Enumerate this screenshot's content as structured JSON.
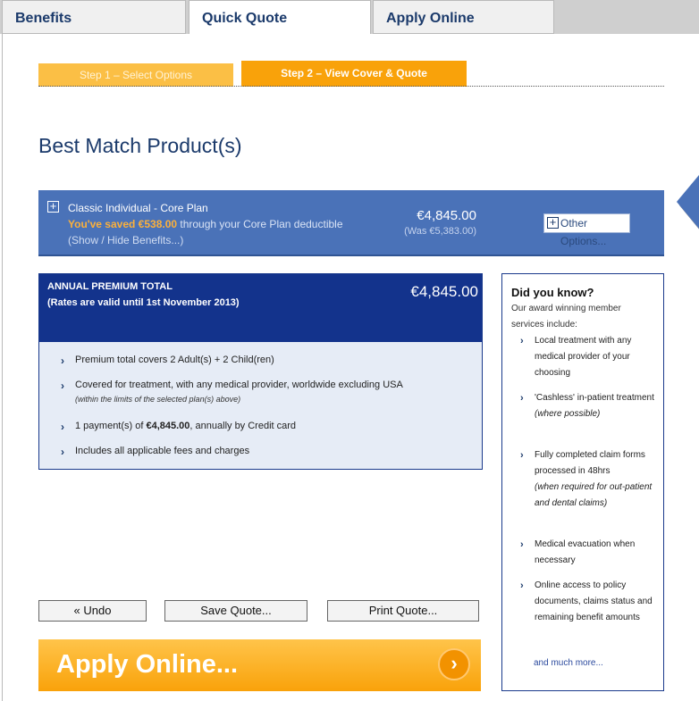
{
  "tabs": [
    {
      "label": "Benefits"
    },
    {
      "label": "Quick Quote"
    },
    {
      "label": "Apply Online"
    }
  ],
  "steps": [
    {
      "label": "Step 1 – Select Options"
    },
    {
      "label": "Step 2 – View Cover & Quote"
    }
  ],
  "page_title": "Best Match Product(s)",
  "plan": {
    "name": "Classic Individual - Core Plan",
    "saved_highlight": "You've saved €538.00",
    "saved_rest": " through your Core Plan deductible",
    "toggle": "(Show / Hide Benefits...)",
    "price": "€4,845.00",
    "was_price": "(Was €5,383.00)",
    "other_options": "Other Options..."
  },
  "premium": {
    "title": "ANNUAL PREMIUM TOTAL",
    "rates": "(Rates are valid until 1st November 2013)",
    "total": "€4,845.00",
    "items": [
      {
        "text": "Premium total covers 2 Adult(s) + 2 Child(ren)"
      },
      {
        "text": "Covered for treatment, with any medical provider, worldwide excluding USA",
        "sub": "(within the limits of the selected plan(s) above)"
      },
      {
        "pre": "1 payment(s) of ",
        "bold": "€4,845.00",
        "post": ", annually by Credit card"
      },
      {
        "text": "Includes all applicable fees and charges"
      }
    ]
  },
  "did_you_know": {
    "title": "Did you know?",
    "intro": "Our award winning member services include:",
    "items": [
      {
        "text": "Local treatment with any medical provider of your choosing",
        "note": ""
      },
      {
        "text": "'Cashless' in-patient treatment",
        "note": "(where possible)"
      },
      {
        "text": "Fully completed claim forms processed in 48hrs",
        "note": "(when required for out-patient and dental claims)"
      },
      {
        "text": "Medical evacuation when necessary",
        "note": ""
      },
      {
        "text": "Online access to policy documents, claims status and remaining benefit amounts",
        "note": ""
      }
    ],
    "more": "and much more..."
  },
  "buttons": {
    "undo": "« Undo",
    "save": "Save Quote...",
    "print": "Print Quote..."
  },
  "apply_online": "Apply Online...",
  "icons": {
    "chevron": "chevron-right-icon",
    "plus": "plus-icon"
  },
  "colors": {
    "brand_blue": "#13338c",
    "plan_blue": "#4a72b8",
    "accent_orange": "#f9a20a",
    "saved_orange": "#fbb03b"
  }
}
